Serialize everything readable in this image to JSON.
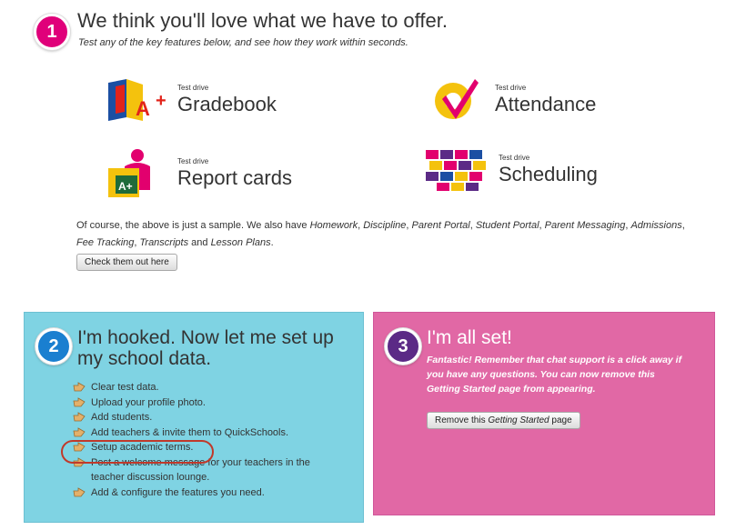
{
  "section1": {
    "number": "1",
    "title": "We think you'll love what we have to offer.",
    "subtitle": "Test any of the key features below, and see how they work within seconds.",
    "features": [
      {
        "kicker": "Test drive",
        "name": "Gradebook"
      },
      {
        "kicker": "Test drive",
        "name": "Attendance"
      },
      {
        "kicker": "Test drive",
        "name": "Report cards"
      },
      {
        "kicker": "Test drive",
        "name": "Scheduling"
      }
    ],
    "sample_intro": "Of course, the above is just a sample. We also have ",
    "sample_items": [
      "Homework",
      "Discipline",
      "Parent Portal",
      "Student Portal",
      "Parent Messaging",
      "Admissions",
      "Fee Tracking",
      "Transcripts",
      "Lesson Plans"
    ],
    "sample_and": " and ",
    "sample_end": ".",
    "button_label": "Check them out here"
  },
  "section2": {
    "number": "2",
    "title": "I'm hooked. Now let me set up my school data.",
    "items": [
      "Clear test data.",
      "Upload your profile photo.",
      "Add students.",
      "Add teachers & invite them to QuickSchools.",
      "Setup academic terms.",
      "Post a welcome message for your teachers in the teacher discussion lounge.",
      "Add & configure the features you need."
    ]
  },
  "section3": {
    "number": "3",
    "title": "I'm all set!",
    "text": "Fantastic! Remember that chat support is a click away if you have any questions. You can now remove this Getting Started page from appearing.",
    "button_prefix": "Remove this ",
    "button_italic": "Getting Started",
    "button_suffix": " page"
  },
  "colors": {
    "step1": "#e0007a",
    "step2": "#1a7fd0",
    "step3": "#5b2a86",
    "panel2": "#7fd3e3",
    "panel3": "#e168a5"
  }
}
